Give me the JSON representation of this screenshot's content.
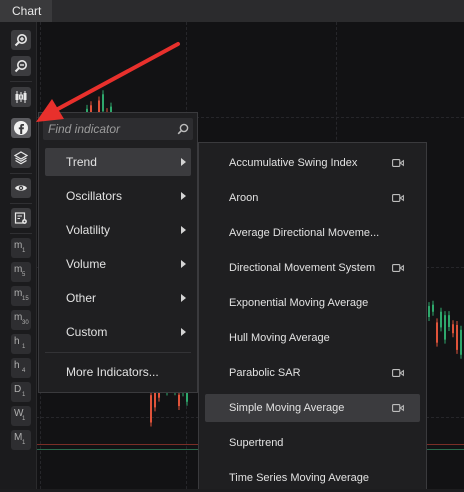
{
  "tab": {
    "label": "Chart"
  },
  "toolbar": {
    "buttons": [
      {
        "icon": "zoom-in-icon"
      },
      {
        "icon": "zoom-out-icon"
      },
      {
        "icon": "candlestick-icon"
      },
      {
        "icon": "indicators-icon"
      },
      {
        "icon": "layers-icon"
      },
      {
        "icon": "eye-icon"
      },
      {
        "icon": "settings-icon"
      }
    ],
    "timeframes": [
      {
        "label": "m",
        "sub": "1"
      },
      {
        "label": "m",
        "sub": "5"
      },
      {
        "label": "m",
        "sub": "15"
      },
      {
        "label": "m",
        "sub": "30"
      },
      {
        "label": "h",
        "sub": "1"
      },
      {
        "label": "h",
        "sub": "4"
      },
      {
        "label": "D",
        "sub": "1"
      },
      {
        "label": "W",
        "sub": "1"
      },
      {
        "label": "M",
        "sub": "1"
      }
    ]
  },
  "menu": {
    "search_placeholder": "Find indicator",
    "categories": [
      {
        "label": "Trend",
        "active": true
      },
      {
        "label": "Oscillators"
      },
      {
        "label": "Volatility"
      },
      {
        "label": "Volume"
      },
      {
        "label": "Other"
      },
      {
        "label": "Custom"
      }
    ],
    "more": "More Indicators..."
  },
  "submenu": {
    "items": [
      {
        "label": "Accumulative Swing Index",
        "camera": true
      },
      {
        "label": "Aroon",
        "camera": true
      },
      {
        "label": "Average Directional Moveme..."
      },
      {
        "label": "Directional Movement System",
        "camera": true
      },
      {
        "label": "Exponential Moving Average"
      },
      {
        "label": "Hull Moving Average"
      },
      {
        "label": "Parabolic SAR",
        "camera": true
      },
      {
        "label": "Simple Moving Average",
        "camera": true,
        "highlighted": true
      },
      {
        "label": "Supertrend"
      },
      {
        "label": "Time Series Moving Average"
      }
    ]
  },
  "colors": {
    "bull": "#2ea86c",
    "bear": "#e0533a",
    "arrow": "#e8302c"
  }
}
